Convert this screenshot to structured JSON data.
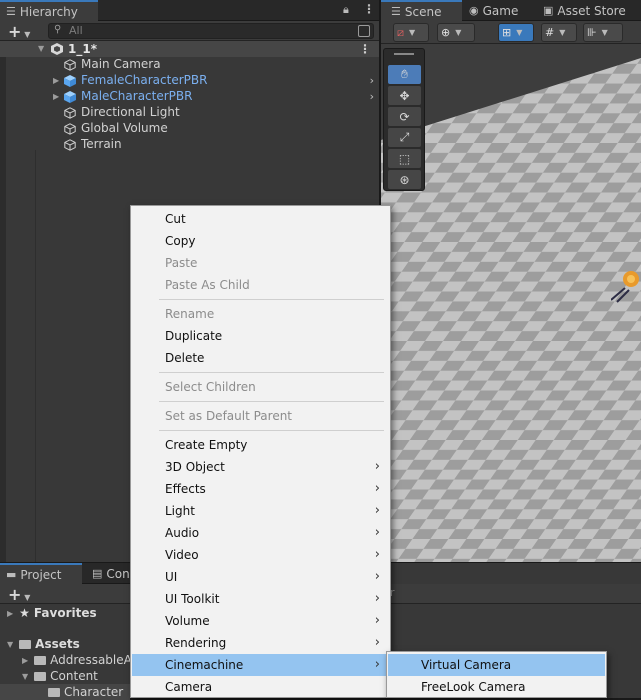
{
  "hierarchy": {
    "tab_label": "Hierarchy",
    "search_placeholder": "All",
    "scene_name": "1_1*",
    "items": [
      {
        "label": "Main Camera",
        "prefab": false,
        "has_children": false
      },
      {
        "label": "FemaleCharacterPBR",
        "prefab": true,
        "has_children": true
      },
      {
        "label": "MaleCharacterPBR",
        "prefab": true,
        "has_children": true
      },
      {
        "label": "Directional Light",
        "prefab": false,
        "has_children": false
      },
      {
        "label": "Global Volume",
        "prefab": false,
        "has_children": false
      },
      {
        "label": "Terrain",
        "prefab": false,
        "has_children": false
      }
    ]
  },
  "scene_tabs": {
    "scene": "Scene",
    "game": "Game",
    "asset_store": "Asset Store"
  },
  "project": {
    "tab_project": "Project",
    "tab_console": "Con",
    "favorites": "Favorites",
    "assets": "Assets",
    "folders": [
      "AddressableA",
      "Content",
      "Character"
    ]
  },
  "context_menu": {
    "groups": [
      [
        {
          "label": "Cut",
          "enabled": true,
          "submenu": false
        },
        {
          "label": "Copy",
          "enabled": true,
          "submenu": false
        },
        {
          "label": "Paste",
          "enabled": false,
          "submenu": false
        },
        {
          "label": "Paste As Child",
          "enabled": false,
          "submenu": false
        }
      ],
      [
        {
          "label": "Rename",
          "enabled": false,
          "submenu": false
        },
        {
          "label": "Duplicate",
          "enabled": true,
          "submenu": false
        },
        {
          "label": "Delete",
          "enabled": true,
          "submenu": false
        }
      ],
      [
        {
          "label": "Select Children",
          "enabled": false,
          "submenu": false
        }
      ],
      [
        {
          "label": "Set as Default Parent",
          "enabled": false,
          "submenu": false
        }
      ],
      [
        {
          "label": "Create Empty",
          "enabled": true,
          "submenu": false
        },
        {
          "label": "3D Object",
          "enabled": true,
          "submenu": true
        },
        {
          "label": "Effects",
          "enabled": true,
          "submenu": true
        },
        {
          "label": "Light",
          "enabled": true,
          "submenu": true
        },
        {
          "label": "Audio",
          "enabled": true,
          "submenu": true
        },
        {
          "label": "Video",
          "enabled": true,
          "submenu": true
        },
        {
          "label": "UI",
          "enabled": true,
          "submenu": true
        },
        {
          "label": "UI Toolkit",
          "enabled": true,
          "submenu": true
        },
        {
          "label": "Volume",
          "enabled": true,
          "submenu": true
        },
        {
          "label": "Rendering",
          "enabled": true,
          "submenu": true
        },
        {
          "label": "Cinemachine",
          "enabled": true,
          "submenu": true,
          "highlighted": true
        },
        {
          "label": "Camera",
          "enabled": true,
          "submenu": false
        }
      ]
    ]
  },
  "submenu": {
    "items": [
      {
        "label": "Virtual Camera",
        "highlighted": true
      },
      {
        "label": "FreeLook Camera",
        "highlighted": false
      }
    ]
  },
  "colors": {
    "accent": "#3a79bb",
    "prefab_text": "#7bb0f0",
    "menu_highlight": "#94c4f0"
  }
}
